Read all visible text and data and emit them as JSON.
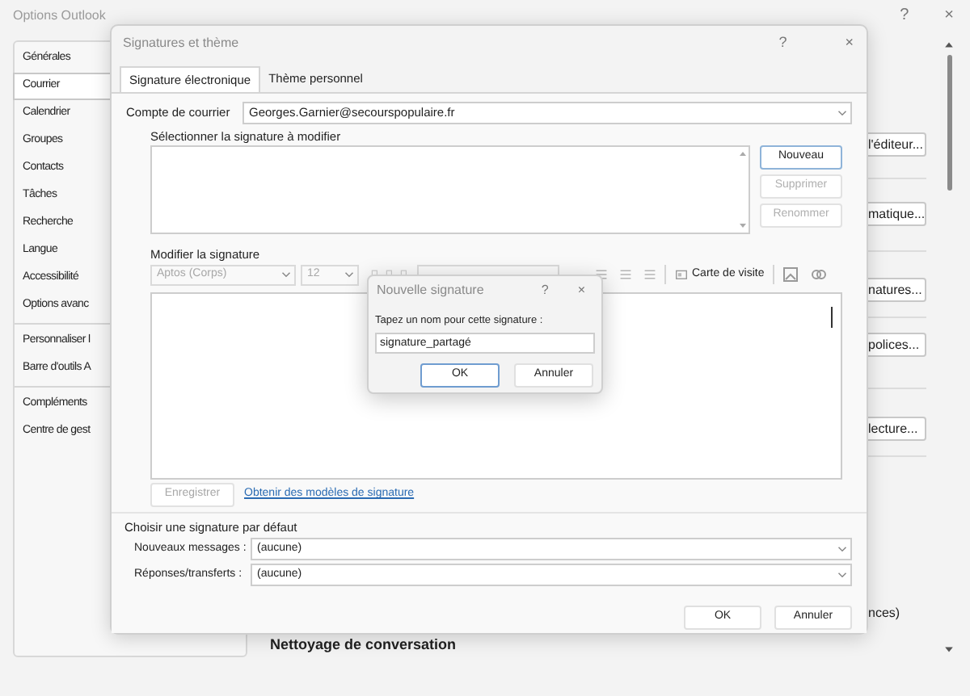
{
  "window": {
    "title": "Options Outlook",
    "controls": [
      "?",
      "×"
    ]
  },
  "sidebar": {
    "items": [
      {
        "label": "Générales",
        "selected": false,
        "group_end": false
      },
      {
        "label": "Courrier",
        "selected": true,
        "group_end": false
      },
      {
        "label": "Calendrier",
        "selected": false,
        "group_end": false
      },
      {
        "label": "Groupes",
        "selected": false,
        "group_end": false
      },
      {
        "label": "Contacts",
        "selected": false,
        "group_end": false
      },
      {
        "label": "Tâches",
        "selected": false,
        "group_end": false
      },
      {
        "label": "Recherche",
        "selected": false,
        "group_end": false
      },
      {
        "label": "Langue",
        "selected": false,
        "group_end": false
      },
      {
        "label": "Accessibilité",
        "selected": false,
        "group_end": false
      },
      {
        "label": "Options avanc",
        "selected": false,
        "group_end": true
      },
      {
        "label": "Personnaliser l",
        "selected": false,
        "group_end": false
      },
      {
        "label": "Barre d'outils A",
        "selected": false,
        "group_end": true
      },
      {
        "label": "Compléments",
        "selected": false,
        "group_end": false
      },
      {
        "label": "Centre de gest",
        "selected": false,
        "group_end": false
      }
    ]
  },
  "background_buttons": [
    "l'éditeur...",
    "matique...",
    "natures...",
    "polices...",
    "lecture..."
  ],
  "background_text": {
    "note": "nces)",
    "heading": "Nettoyage de conversation"
  },
  "dialog": {
    "title": "Signatures et thème",
    "controls": [
      "?",
      "×"
    ],
    "tabs": [
      {
        "label": "Signature électronique",
        "selected": true
      },
      {
        "label": "Thème personnel",
        "selected": false
      }
    ],
    "account": {
      "label": "Compte de courrier",
      "value": "Georges.Garnier@secourspopulaire.fr"
    },
    "select_label": "Sélectionner la signature à modifier",
    "side_buttons": [
      {
        "label": "Nouveau",
        "disabled": false
      },
      {
        "label": "Supprimer",
        "disabled": true
      },
      {
        "label": "Renommer",
        "disabled": true
      }
    ],
    "edit_label": "Modifier la signature",
    "toolbar": {
      "disabled": true,
      "font": "Aptos (Corps)",
      "size": "12",
      "business_card": "Carte de visite"
    },
    "save_button": {
      "label": "Enregistrer",
      "disabled": true
    },
    "templates_link": "Obtenir des modèles de signature",
    "defaults": {
      "title": "Choisir une signature par défaut",
      "rows": [
        {
          "label": "Nouveaux messages :",
          "value": "(aucune)"
        },
        {
          "label": "Réponses/transferts :",
          "value": "(aucune)"
        }
      ]
    },
    "buttons": [
      "OK",
      "Annuler"
    ]
  },
  "new_signature_dialog": {
    "title": "Nouvelle signature",
    "controls": [
      "?",
      "×"
    ],
    "prompt": "Tapez un nom pour cette signature :",
    "value": "signature_partagé",
    "buttons": [
      {
        "label": "OK",
        "default": true
      },
      {
        "label": "Annuler",
        "default": false
      }
    ]
  }
}
